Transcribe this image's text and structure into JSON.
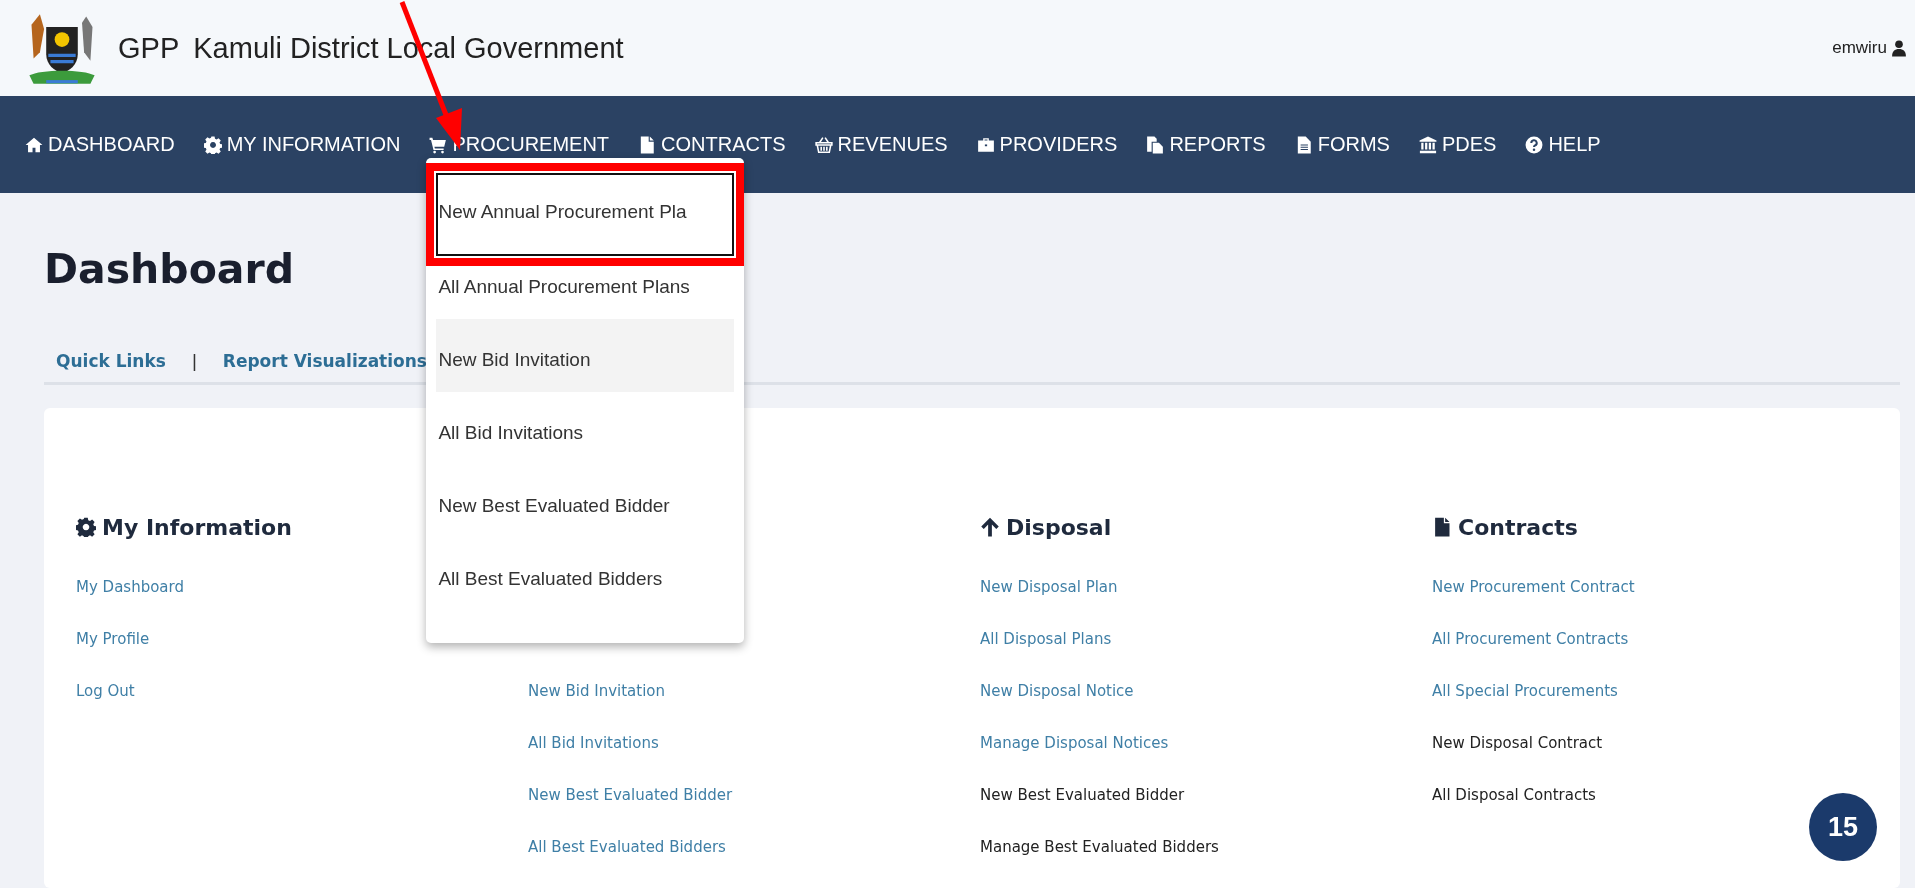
{
  "header": {
    "brand": "GPP",
    "title": "Kamuli District Local Government",
    "user": "emwiru"
  },
  "nav": [
    {
      "label": "DASHBOARD"
    },
    {
      "label": "MY INFORMATION"
    },
    {
      "label": "PROCUREMENT",
      "menu": [
        {
          "label": "New Annual Procurement Pla",
          "focused": true,
          "hovered": false,
          "annotated": true
        },
        {
          "label": "All Annual Procurement Plans",
          "focused": false,
          "hovered": false,
          "annotated": false
        },
        {
          "label": "New Bid Invitation",
          "focused": false,
          "hovered": true,
          "annotated": false
        },
        {
          "label": "All Bid Invitations",
          "focused": false,
          "hovered": false,
          "annotated": false
        },
        {
          "label": "New Best Evaluated Bidder",
          "focused": false,
          "hovered": false,
          "annotated": false
        },
        {
          "label": "All Best Evaluated Bidders",
          "focused": false,
          "hovered": false,
          "annotated": false
        }
      ]
    },
    {
      "label": "CONTRACTS"
    },
    {
      "label": "REVENUES"
    },
    {
      "label": "PROVIDERS"
    },
    {
      "label": "REPORTS"
    },
    {
      "label": "FORMS"
    },
    {
      "label": "PDES"
    },
    {
      "label": "HELP"
    }
  ],
  "page_title": "Dashboard",
  "tabs": [
    {
      "label": "Quick Links"
    },
    {
      "label": "Report Visualizations"
    }
  ],
  "tab_separator": "|",
  "sections": [
    {
      "title": "My Information",
      "links": [
        {
          "label": "My Dashboard",
          "kind": "link"
        },
        {
          "label": "My Profile",
          "kind": "link"
        },
        {
          "label": "Log Out",
          "kind": "link"
        }
      ]
    },
    {
      "links": [
        {
          "label": "New Bid Invitation",
          "kind": "link"
        },
        {
          "label": "All Bid Invitations",
          "kind": "link"
        },
        {
          "label": "New Best Evaluated Bidder",
          "kind": "link"
        },
        {
          "label": "All Best Evaluated Bidders",
          "kind": "link"
        }
      ]
    },
    {
      "title": "Disposal",
      "links": [
        {
          "label": "New Disposal Plan",
          "kind": "link"
        },
        {
          "label": "All Disposal Plans",
          "kind": "link"
        },
        {
          "label": "New Disposal Notice",
          "kind": "link"
        },
        {
          "label": "Manage Disposal Notices",
          "kind": "link"
        },
        {
          "label": "New Best Evaluated Bidder",
          "kind": "text"
        },
        {
          "label": "Manage Best Evaluated Bidders",
          "kind": "text"
        }
      ]
    },
    {
      "title": "Contracts",
      "links": [
        {
          "label": "New Procurement Contract",
          "kind": "link"
        },
        {
          "label": "All Procurement Contracts",
          "kind": "link"
        },
        {
          "label": "All Special Procurements",
          "kind": "link"
        },
        {
          "label": "New Disposal Contract",
          "kind": "text"
        },
        {
          "label": "All Disposal Contracts",
          "kind": "text"
        }
      ]
    }
  ],
  "badge": "15"
}
